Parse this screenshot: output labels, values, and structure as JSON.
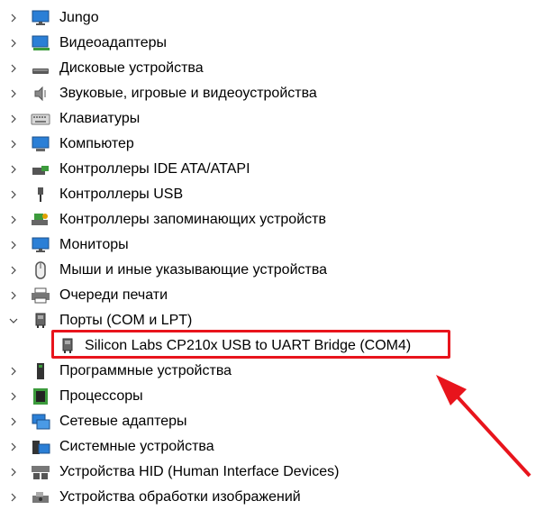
{
  "tree": {
    "items": [
      {
        "label": "Jungo",
        "icon": "monitor-icon",
        "expanded": false
      },
      {
        "label": "Видеоадаптеры",
        "icon": "display-adapter-icon",
        "expanded": false
      },
      {
        "label": "Дисковые устройства",
        "icon": "disk-drive-icon",
        "expanded": false
      },
      {
        "label": "Звуковые, игровые и видеоустройства",
        "icon": "speaker-icon",
        "expanded": false
      },
      {
        "label": "Клавиатуры",
        "icon": "keyboard-icon",
        "expanded": false
      },
      {
        "label": "Компьютер",
        "icon": "computer-icon",
        "expanded": false
      },
      {
        "label": "Контроллеры IDE ATA/ATAPI",
        "icon": "ide-controller-icon",
        "expanded": false
      },
      {
        "label": "Контроллеры USB",
        "icon": "usb-icon",
        "expanded": false
      },
      {
        "label": "Контроллеры запоминающих устройств",
        "icon": "storage-controller-icon",
        "expanded": false
      },
      {
        "label": "Мониторы",
        "icon": "monitor-icon",
        "expanded": false
      },
      {
        "label": "Мыши и иные указывающие устройства",
        "icon": "mouse-icon",
        "expanded": false
      },
      {
        "label": "Очереди печати",
        "icon": "printer-icon",
        "expanded": false
      },
      {
        "label": "Порты (COM и LPT)",
        "icon": "port-icon",
        "expanded": true
      },
      {
        "label": "Программные устройства",
        "icon": "software-device-icon",
        "expanded": false
      },
      {
        "label": "Процессоры",
        "icon": "processor-icon",
        "expanded": false
      },
      {
        "label": "Сетевые адаптеры",
        "icon": "network-adapter-icon",
        "expanded": false
      },
      {
        "label": "Системные устройства",
        "icon": "system-device-icon",
        "expanded": false
      },
      {
        "label": "Устройства HID (Human Interface Devices)",
        "icon": "hid-icon",
        "expanded": false
      },
      {
        "label": "Устройства обработки изображений",
        "icon": "imaging-device-icon",
        "expanded": false
      }
    ],
    "port_child": {
      "label": "Silicon Labs CP210x USB to UART Bridge (COM4)",
      "icon": "port-icon"
    }
  },
  "colors": {
    "highlight": "#e8141c",
    "arrow": "#e8141c",
    "text": "#000000"
  }
}
